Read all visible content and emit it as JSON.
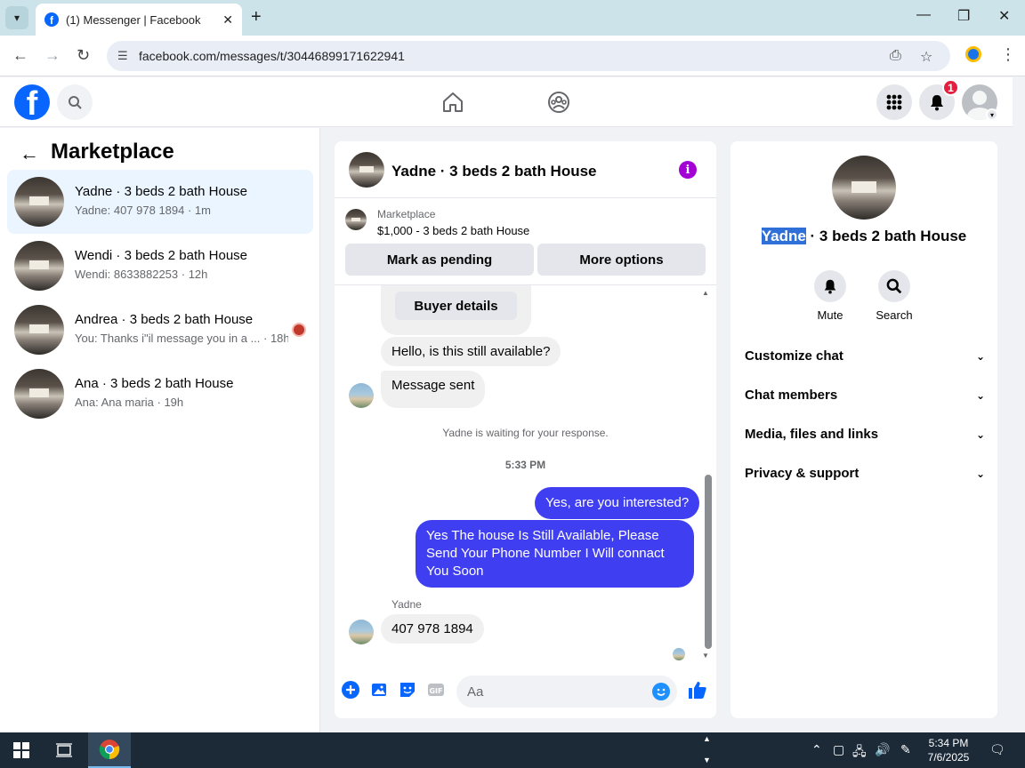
{
  "browser": {
    "tab_title": "(1) Messenger | Facebook",
    "url": "facebook.com/messages/t/30446899171622941"
  },
  "header": {
    "notification_count": "1"
  },
  "sidebar": {
    "title": "Marketplace",
    "conversations": [
      {
        "name": "Yadne · 3 beds 2 bath House",
        "snippet": "Yadne: 407 978 1894 · 1m"
      },
      {
        "name": "Wendi · 3 beds 2 bath House",
        "snippet": "Wendi: 8633882253 · 12h"
      },
      {
        "name": "Andrea · 3 beds 2 bath House",
        "snippet": "You: Thanks i\"il message you in a ... · 18h"
      },
      {
        "name": "Ana · 3 beds 2 bath House",
        "snippet": "Ana: Ana maria · 19h"
      }
    ]
  },
  "chat": {
    "title": "Yadne · 3 beds 2 bath House",
    "marketplace_label": "Marketplace",
    "listing": "$1,000 - 3 beds 2 bath House",
    "mark_pending": "Mark as pending",
    "more_options": "More options",
    "buyer_details": "Buyer details",
    "msg_available": "Hello, is this still available?",
    "msg_sent": "Message sent",
    "waiting": "Yadne is waiting for your response.",
    "time": "5:33 PM",
    "out1": "Yes, are you interested?",
    "out2": "Yes The house Is Still Available, Please Send Your Phone Number I Will connact You Soon",
    "sender": "Yadne",
    "in_phone": "407 978 1894",
    "composer_placeholder": "Aa"
  },
  "details": {
    "name_highlight": "Yadne",
    "name_rest": " · 3 beds 2 bath House",
    "mute": "Mute",
    "search": "Search",
    "items": [
      "Customize chat",
      "Chat members",
      "Media, files and links",
      "Privacy & support"
    ]
  },
  "taskbar": {
    "time": "5:34 PM",
    "date": "7/6/2025"
  },
  "colors": {
    "fb_blue": "#0866ff",
    "outgoing_bubble": "#3f3ef0",
    "info_purple": "#a300d6",
    "notification_red": "#e41e3f"
  }
}
